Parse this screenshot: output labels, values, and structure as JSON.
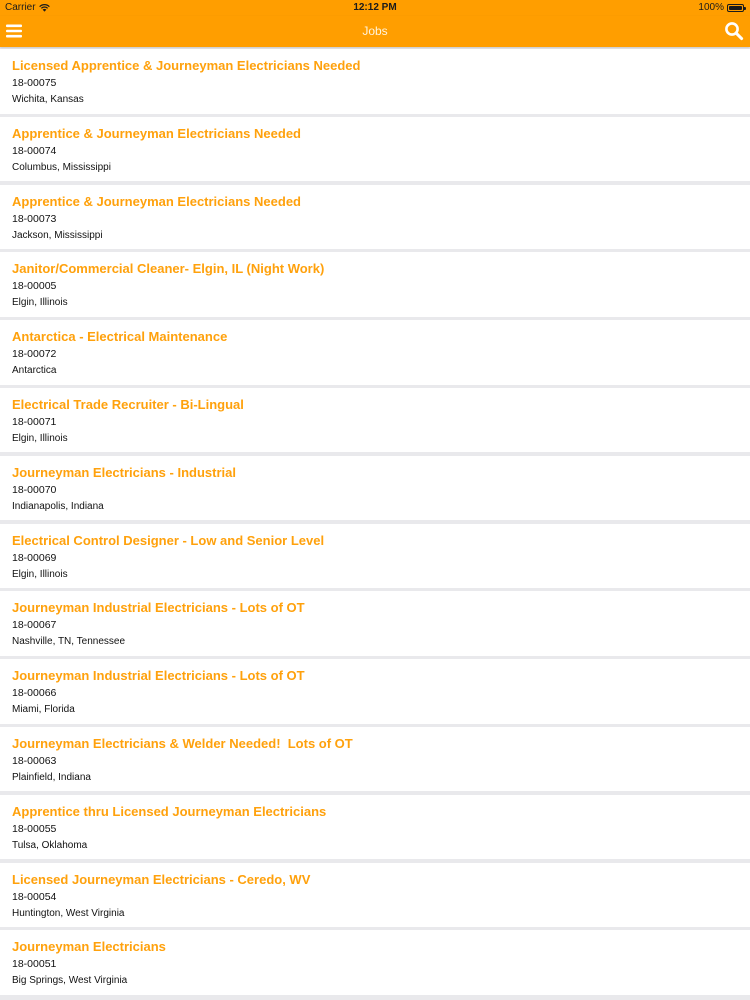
{
  "status_bar": {
    "carrier": "Carrier",
    "time": "12:12 PM",
    "battery_percent_text": "100%",
    "battery_level": 1.0
  },
  "nav": {
    "title": "Jobs",
    "menu_icon": "hamburger-menu-icon",
    "search_icon": "search-icon"
  },
  "colors": {
    "accent": "#ff9e00",
    "title_text": "#ffa10c",
    "body_text": "#111111",
    "background": "#e9e9ec"
  },
  "jobs": [
    {
      "title": "Licensed Apprentice & Journeyman Electricians Needed",
      "number": "18-00075",
      "location": "Wichita, Kansas"
    },
    {
      "title": "Apprentice & Journeyman Electricians Needed",
      "number": "18-00074",
      "location": "Columbus, Mississippi"
    },
    {
      "title": "Apprentice & Journeyman Electricians Needed",
      "number": "18-00073",
      "location": "Jackson, Mississippi"
    },
    {
      "title": "Janitor/Commercial Cleaner- Elgin, IL (Night Work)",
      "number": "18-00005",
      "location": "Elgin, Illinois"
    },
    {
      "title": "Antarctica - Electrical Maintenance",
      "number": "18-00072",
      "location": "Antarctica"
    },
    {
      "title": "Electrical Trade Recruiter - Bi-Lingual",
      "number": "18-00071",
      "location": "Elgin, Illinois"
    },
    {
      "title": "Journeyman Electricians - Industrial",
      "number": "18-00070",
      "location": "Indianapolis, Indiana"
    },
    {
      "title": "Electrical Control Designer - Low and Senior Level",
      "number": "18-00069",
      "location": "Elgin, Illinois"
    },
    {
      "title": "Journeyman Industrial Electricians - Lots of OT",
      "number": "18-00067",
      "location": "Nashville, TN, Tennessee"
    },
    {
      "title": "Journeyman Industrial Electricians - Lots of OT",
      "number": "18-00066",
      "location": "Miami, Florida"
    },
    {
      "title": "Journeyman Electricians & Welder Needed!  Lots of OT",
      "number": "18-00063",
      "location": "Plainfield, Indiana"
    },
    {
      "title": "Apprentice thru Licensed Journeyman Electricians",
      "number": "18-00055",
      "location": "Tulsa, Oklahoma"
    },
    {
      "title": "Licensed Journeyman Electricians - Ceredo, WV",
      "number": "18-00054",
      "location": "Huntington, West Virginia"
    },
    {
      "title": "Journeyman Electricians",
      "number": "18-00051",
      "location": "Big Springs, West Virginia"
    }
  ]
}
